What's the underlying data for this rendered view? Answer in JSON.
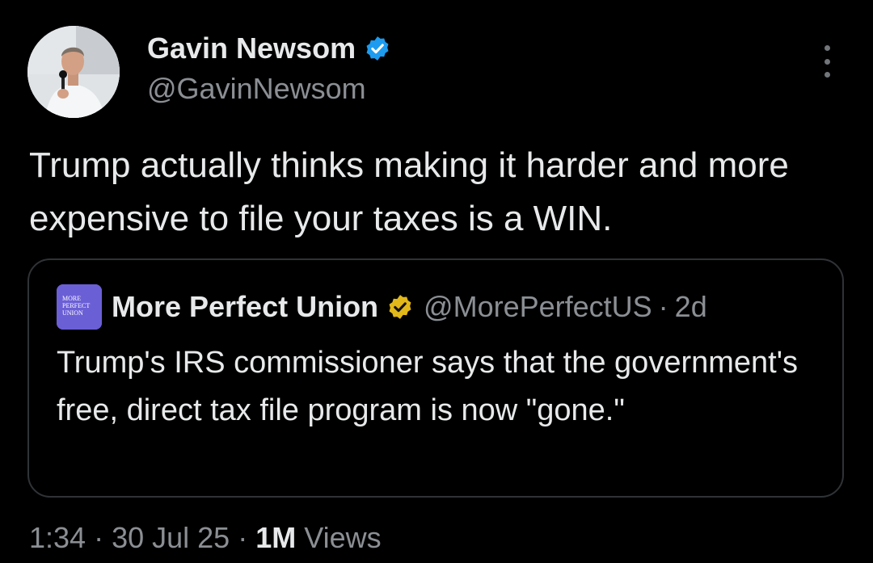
{
  "author": {
    "name": "Gavin Newsom",
    "handle": "@GavinNewsom",
    "verified_color": "#1d9bf0"
  },
  "tweet": {
    "text": "Trump actually thinks making it harder and more expensive to file your taxes is a WIN."
  },
  "quote": {
    "avatar_text": [
      "MORE",
      "PERFECT",
      "UNION"
    ],
    "avatar_color": "#6b5fd6",
    "name": "More Perfect Union",
    "badge_color": "#e2b719",
    "handle": "@MorePerfectUS",
    "separator": "·",
    "time": "2d",
    "text": "Trump's IRS commissioner says that the government's free, direct tax file program is now \"gone.\""
  },
  "meta": {
    "time": "1:34",
    "separator": "·",
    "date": "30 Jul 25",
    "views_count": "1M",
    "views_label": "Views"
  },
  "icons": {
    "more": "more-vertical-icon",
    "verified": "verified-badge-icon",
    "org_verified": "gold-verified-badge-icon"
  }
}
